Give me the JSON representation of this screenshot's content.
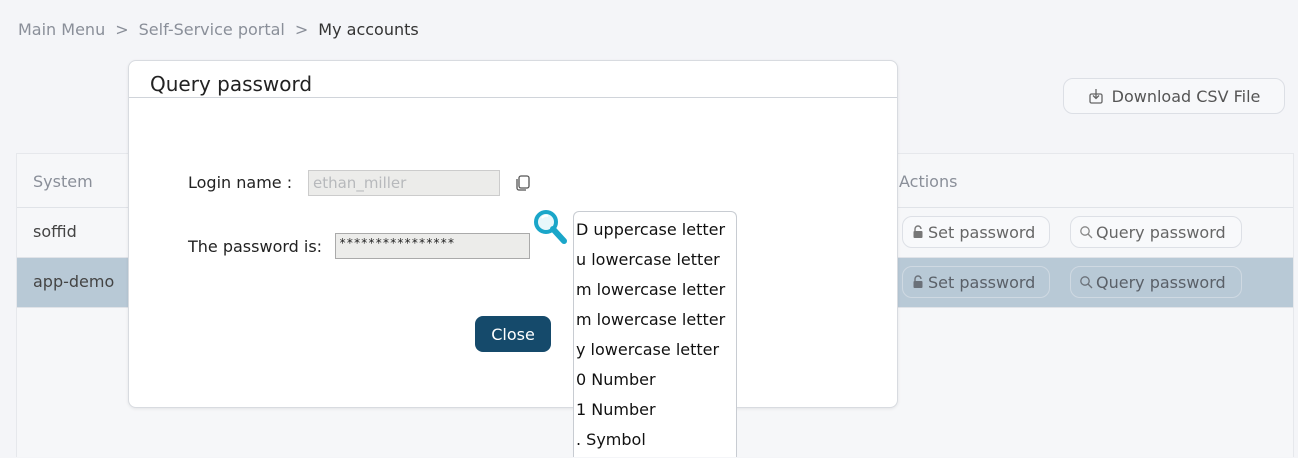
{
  "breadcrumb": {
    "items": [
      "Main Menu",
      "Self-Service portal",
      "My accounts"
    ],
    "separator": ">"
  },
  "toolbar": {
    "download_label": "Download CSV File",
    "download_icon": "download-icon"
  },
  "table": {
    "headers": {
      "system": "System",
      "actions": "Actions"
    },
    "rows": [
      {
        "system": "soffid",
        "set_password": "Set password",
        "query_password": "Query password",
        "selected": false
      },
      {
        "system": "app-demo",
        "set_password": "Set password",
        "query_password": "Query password",
        "selected": true
      }
    ]
  },
  "modal": {
    "title": "Query password",
    "login_label": "Login name :",
    "login_value": "ethan_miller",
    "password_label": "The password is:",
    "password_value": "****************",
    "close_label": "Close"
  },
  "password_hint": {
    "items": [
      "D uppercase letter",
      "u lowercase letter",
      "m lowercase letter",
      "m lowercase letter",
      "y lowercase letter",
      "0 Number",
      "1 Number",
      ". Symbol"
    ]
  },
  "colors": {
    "primary_button": "#154a6b",
    "selected_row": "#b8c9d6",
    "magnifier": "#1aa6c9"
  }
}
